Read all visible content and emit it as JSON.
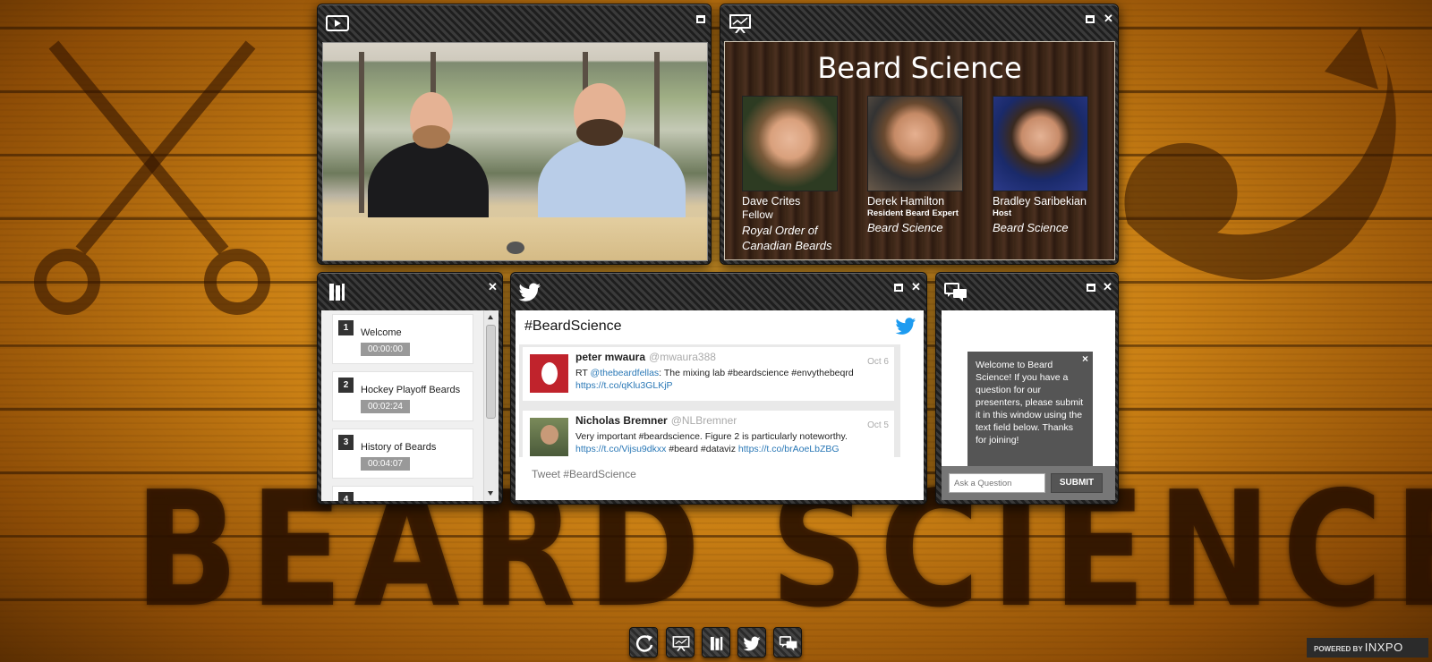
{
  "background": {
    "title": "BEARD SCIENCE"
  },
  "video_panel": {
    "icon": "video-play-icon",
    "maximize_icon": "maximize-icon"
  },
  "slides_panel": {
    "icon": "presentation-icon",
    "slide": {
      "title": "Beard Science",
      "presenters": [
        {
          "name": "Dave Crites",
          "role": "Fellow",
          "org": "Royal Order of Canadian Beards"
        },
        {
          "name": "Derek Hamilton",
          "role": "Resident Beard Expert",
          "org": "Beard Science"
        },
        {
          "name": "Bradley Saribekian",
          "role": "Host",
          "org": "Beard Science"
        }
      ]
    }
  },
  "agenda_panel": {
    "icon": "agenda-icon",
    "items": [
      {
        "num": "1",
        "title": "Welcome",
        "time": "00:00:00"
      },
      {
        "num": "2",
        "title": "Hockey Playoff Beards",
        "time": "00:02:24"
      },
      {
        "num": "3",
        "title": "History of Beards",
        "time": "00:04:07"
      },
      {
        "num": "4",
        "title": "",
        "time": ""
      }
    ]
  },
  "twitter_panel": {
    "icon": "twitter-icon",
    "hashtag": "#BeardScience",
    "tweets": [
      {
        "name": "peter mwaura",
        "handle": "@mwaura388",
        "date": "Oct 6",
        "text_prefix": "RT ",
        "mention": "@thebeardfellas",
        "text_mid": ": The mixing lab #beardscience #envythebeqrd",
        "link1": "https://t.co/qKlu3GLKjP",
        "text_mid2": "",
        "link2": ""
      },
      {
        "name": "Nicholas Bremner",
        "handle": "@NLBremner",
        "date": "Oct 5",
        "text_prefix": "Very important #beardscience. Figure 2 is particularly noteworthy.",
        "mention": "",
        "text_mid": "",
        "link1": "https://t.co/Vijsu9dkxx",
        "text_mid2": " #beard #dataviz ",
        "link2": "https://t.co/brAoeLbZBG"
      }
    ],
    "input_placeholder": "Tweet #BeardScience"
  },
  "qa_panel": {
    "icon": "chat-bubbles-icon",
    "welcome_message": "Welcome to Beard Science! If you have a question for our presenters, please submit it in this window using the text field below. Thanks for joining!",
    "close_label": "×",
    "input_placeholder": "Ask a Question",
    "submit_label": "SUBMIT"
  },
  "dock": {
    "buttons": [
      "refresh-icon",
      "presentation-icon",
      "agenda-icon",
      "twitter-icon",
      "chat-bubbles-icon"
    ]
  },
  "footer": {
    "powered_prefix": "POWERED BY",
    "brand": "INXPO"
  },
  "colors": {
    "link": "#2a78b6",
    "twitter_blue": "#1d9bf0",
    "panel_dark": "#2a2a2a"
  }
}
